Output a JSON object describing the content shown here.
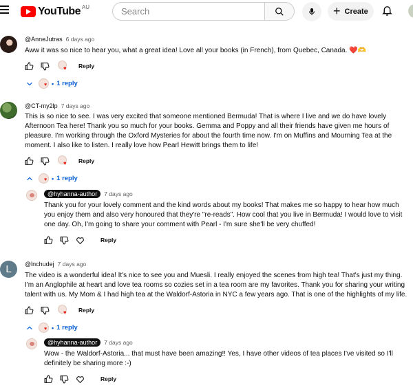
{
  "header": {
    "logo_text": "YouTube",
    "region": "AU",
    "search_placeholder": "Search",
    "create_label": "Create"
  },
  "comments": [
    {
      "avatar_initial": "",
      "handle": "@AnneJutras",
      "age": "6 days ago",
      "text": "Aww it was so nice to hear you, what a great idea! Love all your books (in French), from Quebec, Canada. ❤️🫶",
      "reply_label": "Reply",
      "replies_label": "1 reply"
    },
    {
      "avatar_initial": "",
      "handle": "@CT-my2lp",
      "age": "7 days ago",
      "text": "This is so nice to see. I was very excited that someone mentioned Bermuda! That is where I live and we do have lovely Afternoon Tea here! Thank you so much for your books. Gemma and Poppy and all their friends have given me hours of pleasure. I'm working through the Oxford Mysteries for about the fourth time now. I'm on Muffins and Mourning Tea at the moment. I also like to listen. I really love how Pearl Hewitt brings them to life!",
      "reply_label": "Reply",
      "replies_label": "1 reply",
      "reply": {
        "handle": "@hyhanna-author",
        "age": "7 days ago",
        "text": "Thank you for your lovely comment and the kind words about my books! That makes me so happy to hear how much you enjoy them and also very honoured that they're \"re-reads\". How cool that you live in Bermuda! I would love to visit one day. Oh, I'm going to share your comment with Pearl - I'm sure she'll be very chuffed!",
        "reply_label": "Reply"
      }
    },
    {
      "avatar_initial": "L",
      "handle": "@lnchudej",
      "age": "7 days ago",
      "text": "The video is a wonderful idea! It's nice to see you and Muesli. I really enjoyed the scenes from high tea! That's just my thing. I'm an Anglophile at heart and love tea rooms so cozies set in a tea room are my favorites. Thank you for sharing your writing talent with us. My Mom & I had high tea at the Waldorf-Astoria in NYC a few years ago. That is one of the highlights of my life.",
      "reply_label": "Reply",
      "replies_label": "1 reply",
      "reply": {
        "handle": "@hyhanna-author",
        "age": "7 days ago",
        "text": "Wow - the Waldorf-Astoria... that must have been amazing!! Yes, I have other videos of tea places I've visited so I'll definitely be sharing more :-)",
        "reply_label": "Reply"
      }
    }
  ],
  "colors": {
    "brand_red": "#ff0000",
    "link_blue": "#065fd4",
    "heart_red": "#e62117"
  }
}
